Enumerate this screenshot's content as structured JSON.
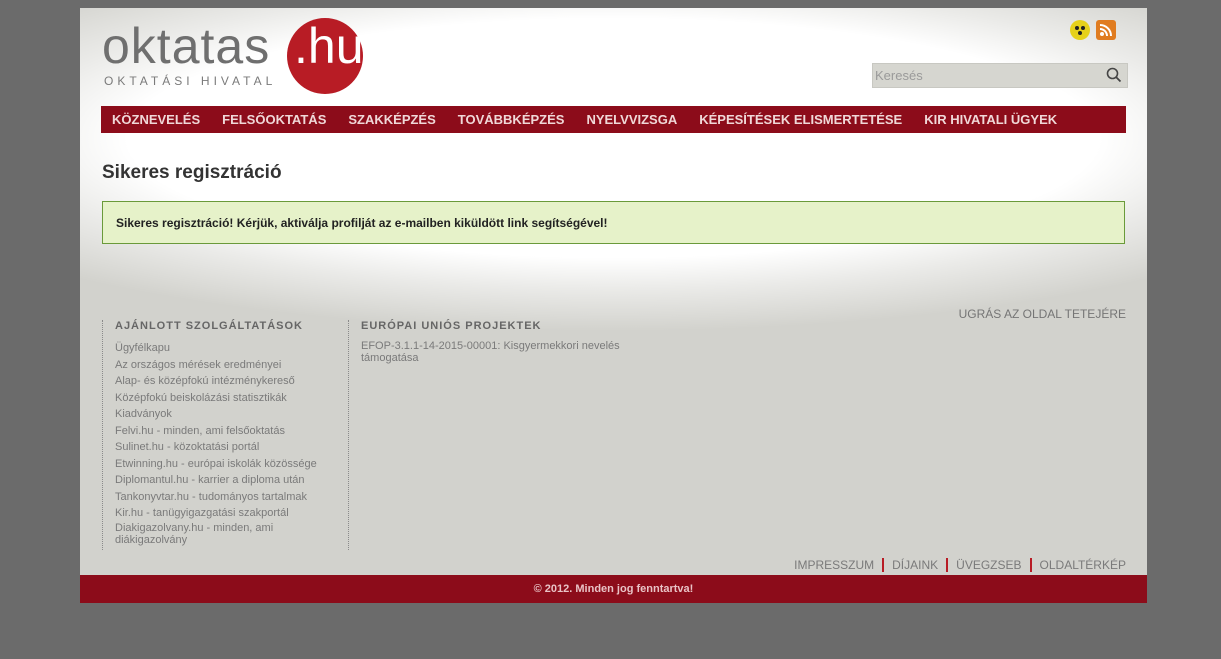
{
  "header": {
    "logo_main": "oktatas",
    "logo_hu": ".hu",
    "logo_subtitle": "OKTATÁSI HIVATAL",
    "icons": [
      "accessibility-icon",
      "rss-icon"
    ],
    "search": {
      "placeholder": "Keresés"
    }
  },
  "nav": {
    "items": [
      "KÖZNEVELÉS",
      "FELSŐOKTATÁS",
      "SZAKKÉPZÉS",
      "TOVÁBBKÉPZÉS",
      "NYELVVIZSGA",
      "KÉPESÍTÉSEK ELISMERTETÉSE",
      "KIR HIVATALI ÜGYEK"
    ]
  },
  "main": {
    "title": "Sikeres regisztráció",
    "success_message": "Sikeres regisztráció! Kérjük, aktiválja profilját az e-mailben kiküldött link segítségével!"
  },
  "footer": {
    "back_to_top": "UGRÁS AZ OLDAL TETEJÉRE",
    "services": {
      "heading": "AJÁNLOTT SZOLGÁLTATÁSOK",
      "links": [
        "Ügyfélkapu",
        "Az országos mérések eredményei",
        "Alap- és középfokú intézménykereső",
        "Középfokú beiskolázási statisztikák",
        "Kiadványok",
        "Felvi.hu - minden, ami felsőoktatás",
        "Sulinet.hu - közoktatási portál",
        "Etwinning.hu - európai iskolák közössége",
        "Diplomantul.hu - karrier a diploma után",
        "Tankonyvtar.hu - tudományos tartalmak",
        "Kir.hu - tanügyigazgatási szakportál",
        "Diakigazolvany.hu - minden, ami diákigazolvány"
      ]
    },
    "eu_projects": {
      "heading": "EURÓPAI UNIÓS PROJEKTEK",
      "links": [
        "EFOP-3.1.1-14-2015-00001: Kisgyermekkori nevelés támogatása"
      ]
    },
    "bottom_links": [
      "IMPRESSZUM",
      "DÍJAINK",
      "ÜVEGZSEB",
      "OLDALTÉRKÉP"
    ],
    "copyright": "© 2012. Minden jog fenntartva!"
  },
  "colors": {
    "brand_red": "#b81c25",
    "nav_red": "#8c0c1a",
    "success_bg": "#e6f2c9",
    "success_border": "#6a9a3a"
  }
}
